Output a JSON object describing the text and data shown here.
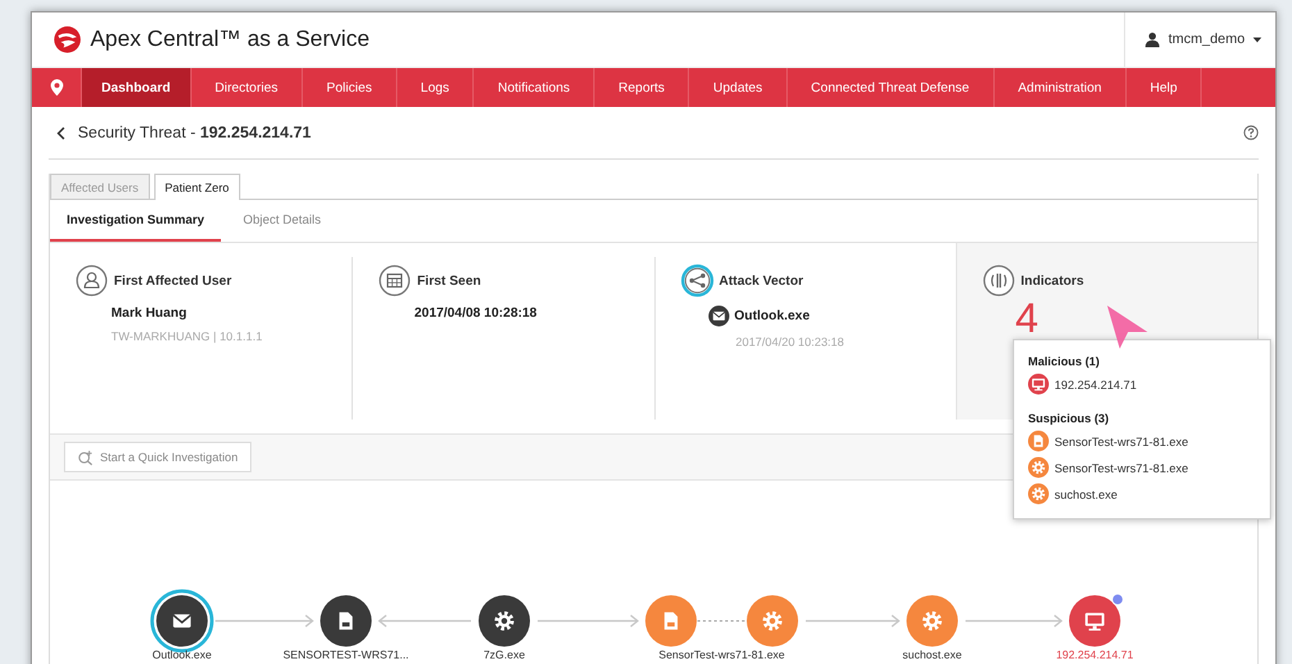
{
  "header": {
    "title": "Apex Central™ as a Service",
    "user": "tmcm_demo"
  },
  "nav": {
    "items": [
      {
        "label": "Dashboard",
        "selected": true
      },
      {
        "label": "Directories",
        "selected": false
      },
      {
        "label": "Policies",
        "selected": false
      },
      {
        "label": "Logs",
        "selected": false
      },
      {
        "label": "Notifications",
        "selected": false
      },
      {
        "label": "Reports",
        "selected": false
      },
      {
        "label": "Updates",
        "selected": false
      },
      {
        "label": "Connected Threat Defense",
        "selected": false
      },
      {
        "label": "Administration",
        "selected": false
      },
      {
        "label": "Help",
        "selected": false
      }
    ]
  },
  "breadcrumb": "Security Threat - **192.254.214.71**",
  "tabs": [
    {
      "label": "Affected Users",
      "selected": false
    },
    {
      "label": "Patient Zero",
      "selected": true
    }
  ],
  "subtabs": [
    {
      "label": "Investigation Summary",
      "selected": true
    },
    {
      "label": "Object Details",
      "selected": false
    }
  ],
  "summary": [
    {
      "kind": "user",
      "title": "First Affected User",
      "highlighted": false,
      "primary": "Mark Huang",
      "secondary": "TW-MARKHUANG | 10.1.1.1"
    },
    {
      "kind": "calendar",
      "title": "First Seen",
      "highlighted": false,
      "primary": "2017/04/08 10:28:18"
    },
    {
      "kind": "vector",
      "title": "Attack Vector",
      "highlighted": true,
      "primary": "Outlook.exe",
      "secondary": "2017/04/20 10:23:18"
    },
    {
      "kind": "indicators",
      "title": "Indicators",
      "highlighted": false,
      "count": "4"
    }
  ],
  "popover": {
    "sections": [
      {
        "title": "Malicious (1)",
        "kind": "malicious",
        "items": [
          {
            "label": "192.254.214.71",
            "kind": "monitor"
          }
        ]
      },
      {
        "title": "Suspicious (3)",
        "kind": "suspicious",
        "items": [
          {
            "label": "SensorTest-wrs71-81.exe",
            "kind": "file"
          },
          {
            "label": "SensorTest-wrs71-81.exe",
            "kind": "gear"
          },
          {
            "label": "suchost.exe",
            "kind": "gear"
          }
        ]
      }
    ]
  },
  "toolbar": {
    "button": "Start a Quick Investigation"
  },
  "graph": {
    "groups": [
      {
        "label": "Outlook.exe",
        "kind": "normal",
        "selected": true,
        "alert": false,
        "nodes": [
          {
            "kind": "mail"
          }
        ]
      },
      {
        "label": "SENSORTEST-WRS71...",
        "kind": "normal",
        "selected": false,
        "alert": false,
        "nodes": [
          {
            "kind": "file"
          }
        ]
      },
      {
        "label": "7zG.exe",
        "kind": "normal",
        "selected": false,
        "alert": false,
        "nodes": [
          {
            "kind": "gear"
          }
        ]
      },
      {
        "label": "SensorTest-wrs71-81.exe",
        "kind": "suspicious",
        "selected": false,
        "alert": false,
        "nodes": [
          {
            "kind": "file"
          },
          {
            "kind": "gear"
          }
        ]
      },
      {
        "label": "suchost.exe",
        "kind": "suspicious",
        "selected": false,
        "alert": false,
        "nodes": [
          {
            "kind": "gear"
          }
        ]
      },
      {
        "label": "192.254.214.71",
        "kind": "malicious",
        "selected": false,
        "alert": true,
        "nodes": [
          {
            "kind": "monitor"
          }
        ]
      }
    ],
    "edges": [
      {
        "kind": "forward"
      },
      {
        "kind": "backward"
      },
      {
        "kind": "forward"
      },
      {
        "kind": "forward"
      },
      {
        "kind": "forward"
      }
    ]
  }
}
